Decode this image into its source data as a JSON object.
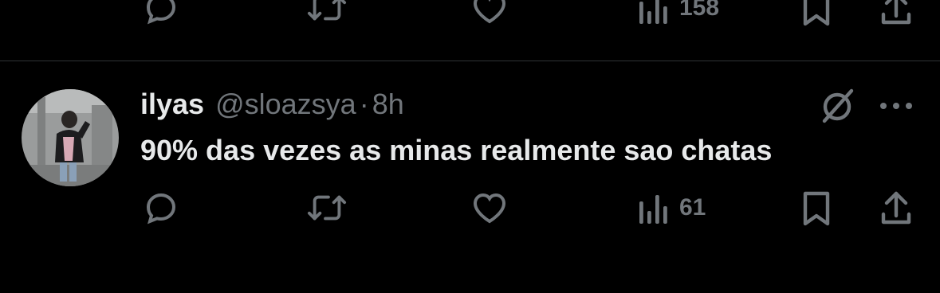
{
  "colors": {
    "background": "#000000",
    "primary_text": "#e7e9ea",
    "secondary_text": "#71767b",
    "divider": "#2f3336"
  },
  "previous_tweet": {
    "actions": {
      "reply_icon": "speech-bubble",
      "retweet_icon": "retweet-arrows",
      "like_icon": "heart",
      "views_icon": "bar-chart",
      "views_count": "158",
      "bookmark_icon": "bookmark",
      "share_icon": "upload-arrow"
    }
  },
  "tweet": {
    "author_name": "ilyas",
    "author_handle": "@sloazsya",
    "separator": "·",
    "time": "8h",
    "text": "90% das vezes as minas realmente sao chatas",
    "actions": {
      "reply_icon": "speech-bubble",
      "retweet_icon": "retweet-arrows",
      "like_icon": "heart",
      "views_icon": "bar-chart",
      "views_count": "61",
      "bookmark_icon": "bookmark",
      "share_icon": "upload-arrow"
    },
    "grok_icon": "grok-slash-circle",
    "more_icon": "ellipsis"
  }
}
